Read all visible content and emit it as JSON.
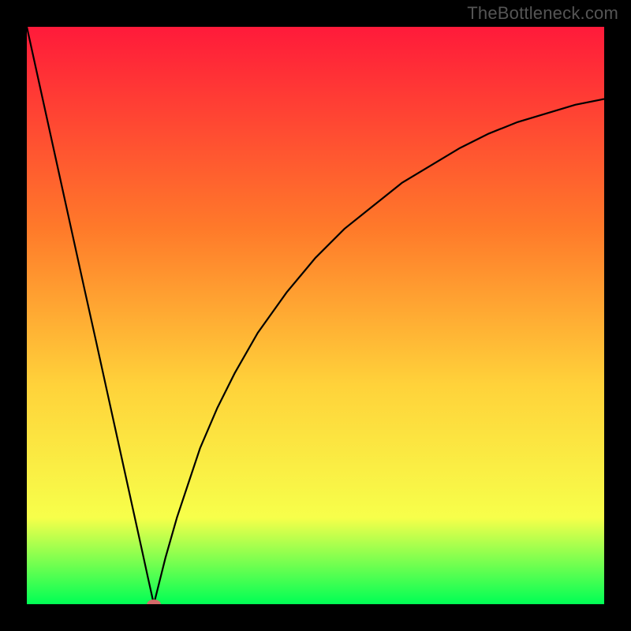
{
  "watermark": "TheBottleneck.com",
  "colors": {
    "frame": "#000000",
    "gradient_top": "#ff1a3a",
    "gradient_mid1": "#ff7a2a",
    "gradient_mid2": "#ffd23a",
    "gradient_mid3": "#f7ff4a",
    "gradient_bottom": "#00ff55",
    "curve": "#000000",
    "marker": "#d46a6a"
  },
  "chart_data": {
    "type": "line",
    "title": "",
    "xlabel": "",
    "ylabel": "",
    "xlim": [
      0,
      100
    ],
    "ylim": [
      0,
      100
    ],
    "grid": false,
    "legend": false,
    "min_point": {
      "x": 22,
      "y": 0
    },
    "series": [
      {
        "name": "bottleneck-curve",
        "x": [
          0,
          2,
          4,
          6,
          8,
          10,
          12,
          14,
          16,
          18,
          20,
          21,
          22,
          23,
          24,
          26,
          28,
          30,
          33,
          36,
          40,
          45,
          50,
          55,
          60,
          65,
          70,
          75,
          80,
          85,
          90,
          95,
          100
        ],
        "y": [
          100,
          90.9,
          81.8,
          72.7,
          63.6,
          54.5,
          45.5,
          36.4,
          27.3,
          18.2,
          9.1,
          4.5,
          0,
          4,
          8,
          15,
          21,
          27,
          34,
          40,
          47,
          54,
          60,
          65,
          69,
          73,
          76,
          79,
          81.5,
          83.5,
          85,
          86.5,
          87.5
        ]
      }
    ],
    "markers": [
      {
        "name": "min-marker",
        "x": 22,
        "y": 0,
        "rx": 1.2,
        "ry": 0.8
      }
    ]
  }
}
